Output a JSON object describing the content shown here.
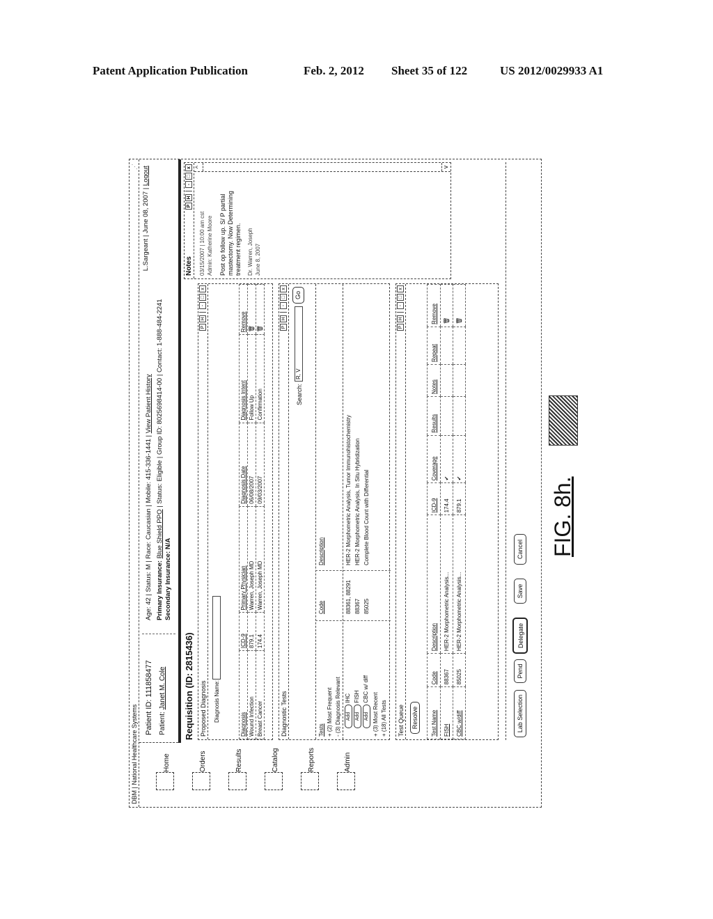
{
  "publication_header": {
    "title": "Patent Application Publication",
    "date": "Feb. 2, 2012",
    "sheet": "Sheet 35 of 122",
    "number": "US 2012/0029933 A1"
  },
  "figure_label": "FIG. 8h.",
  "app": {
    "title": "DBM | National Healthcare Systems"
  },
  "sidebar": {
    "items": [
      {
        "label": "Home",
        "icon": "home-icon"
      },
      {
        "label": "Orders",
        "icon": "orders-icon"
      },
      {
        "label": "Results",
        "icon": "results-icon"
      },
      {
        "label": "Catalog",
        "icon": "catalog-icon"
      },
      {
        "label": "Reports",
        "icon": "reports-icon"
      },
      {
        "label": "Admin",
        "icon": "admin-icon"
      }
    ]
  },
  "patient": {
    "id_line": "Patient ID: 111858477",
    "name_label": "Patient:",
    "name": "Janet M. Cole",
    "line1_prefix": "Age: 42  |  Status: M  |  Race: Caucasian  |  Mobile: 415-336-1441  |",
    "view_history": "View Patient History",
    "line2_prefix": "Primary Insurance:",
    "primary_insurance": "Blue Shield PPO",
    "line2_suffix": "|  Status: Eligible  |  Group ID: 8025698414-00  |  Contact: 1-888-484-2241",
    "line3": "Secondary Insurance: N/A"
  },
  "user": {
    "name": "L.Sargeant",
    "date": "June 08, 2007",
    "logout": "Logout"
  },
  "requisition": {
    "title": "Requisition (ID: 2815436)"
  },
  "window_buttons": {
    "p": "P",
    "h": "H",
    "min": "-",
    "max": "□",
    "close": "x"
  },
  "proposed_diagnosis": {
    "title": "Proposed Diagnosis",
    "name_label": "Diagnosis Name:",
    "name_value": "",
    "columns": [
      "Diagnosis",
      "ICD-9",
      "Primary Physician",
      "Diagnosis Date",
      "Diagnosis Intent",
      "Remove"
    ],
    "rows": [
      [
        "Wound Infection",
        "879.1",
        "Warren, Joseph MD",
        "06/08/2007",
        "Follow Up",
        "🗑"
      ],
      [
        "Breast Cancer",
        "174.4",
        "Warren, Joseph MD",
        "09/03/2007",
        "Confirmation",
        "🗑"
      ]
    ]
  },
  "diagnostic_tests": {
    "title": "Diagnostic Tests",
    "search_label": "Search:",
    "search_value": "R, V",
    "go_label": "Go",
    "tests_header": "Tests",
    "codes_header": "Code",
    "description_header": "Description",
    "groups": [
      {
        "label": "(2) Most Frequent",
        "expand": "+"
      },
      {
        "label": "(3) Diagnosis Relevant",
        "expand": "-"
      }
    ],
    "rows": [
      {
        "add": "Add",
        "test": "IHC",
        "code": "88361, 88291",
        "description": "HER-2 Morphometric Analysis, Tumor Immunohistochemistry"
      },
      {
        "add": "Add",
        "test": "FISH",
        "code": "88367",
        "description": "HER-2 Morphometric Analysis, In Situ Hybridization"
      },
      {
        "add": "Add",
        "test": "CBC w/ diff",
        "code": "85025",
        "description": "Complete Blood Count with Differential"
      }
    ],
    "more_groups": [
      {
        "label": "(3) Most Recent",
        "expand": "+"
      },
      {
        "label": "(18) All Tests",
        "expand": "+"
      }
    ]
  },
  "test_queue": {
    "title": "Test Queue",
    "resolve_label": "Resolve",
    "columns": [
      "Test Name",
      "Code",
      "Description",
      "ICD-9",
      "Coverage",
      "Results",
      "Notes",
      "Repeat",
      "Remove"
    ],
    "rows": [
      [
        "FISH",
        "88367",
        "HER-2 Morphometric Analysis...",
        "174.4",
        "✔",
        "",
        "",
        "",
        "🗑"
      ],
      [
        "CBC w/diff",
        "85025",
        "HER-2 Morphometric Analysis...",
        "879.1",
        "✔",
        "",
        "",
        "",
        "🗑"
      ]
    ]
  },
  "notes": {
    "title": "Notes",
    "timestamp": "03/15/2007  |  10:00 am cst",
    "author": "Admin: Katherine Moore",
    "body": "Post op follow up. S/ P partial mastectomy. Now Determining treatment regimen.",
    "signature": "Dr. Warren, Joseph",
    "sig_date": "June 8, 2007",
    "scroll_up": "^",
    "scroll_down": "v"
  },
  "actions": {
    "lab_selection": "Lab Selection",
    "pend": "Pend",
    "delegate": "Delegate",
    "save": "Save",
    "cancel": "Cancel"
  }
}
